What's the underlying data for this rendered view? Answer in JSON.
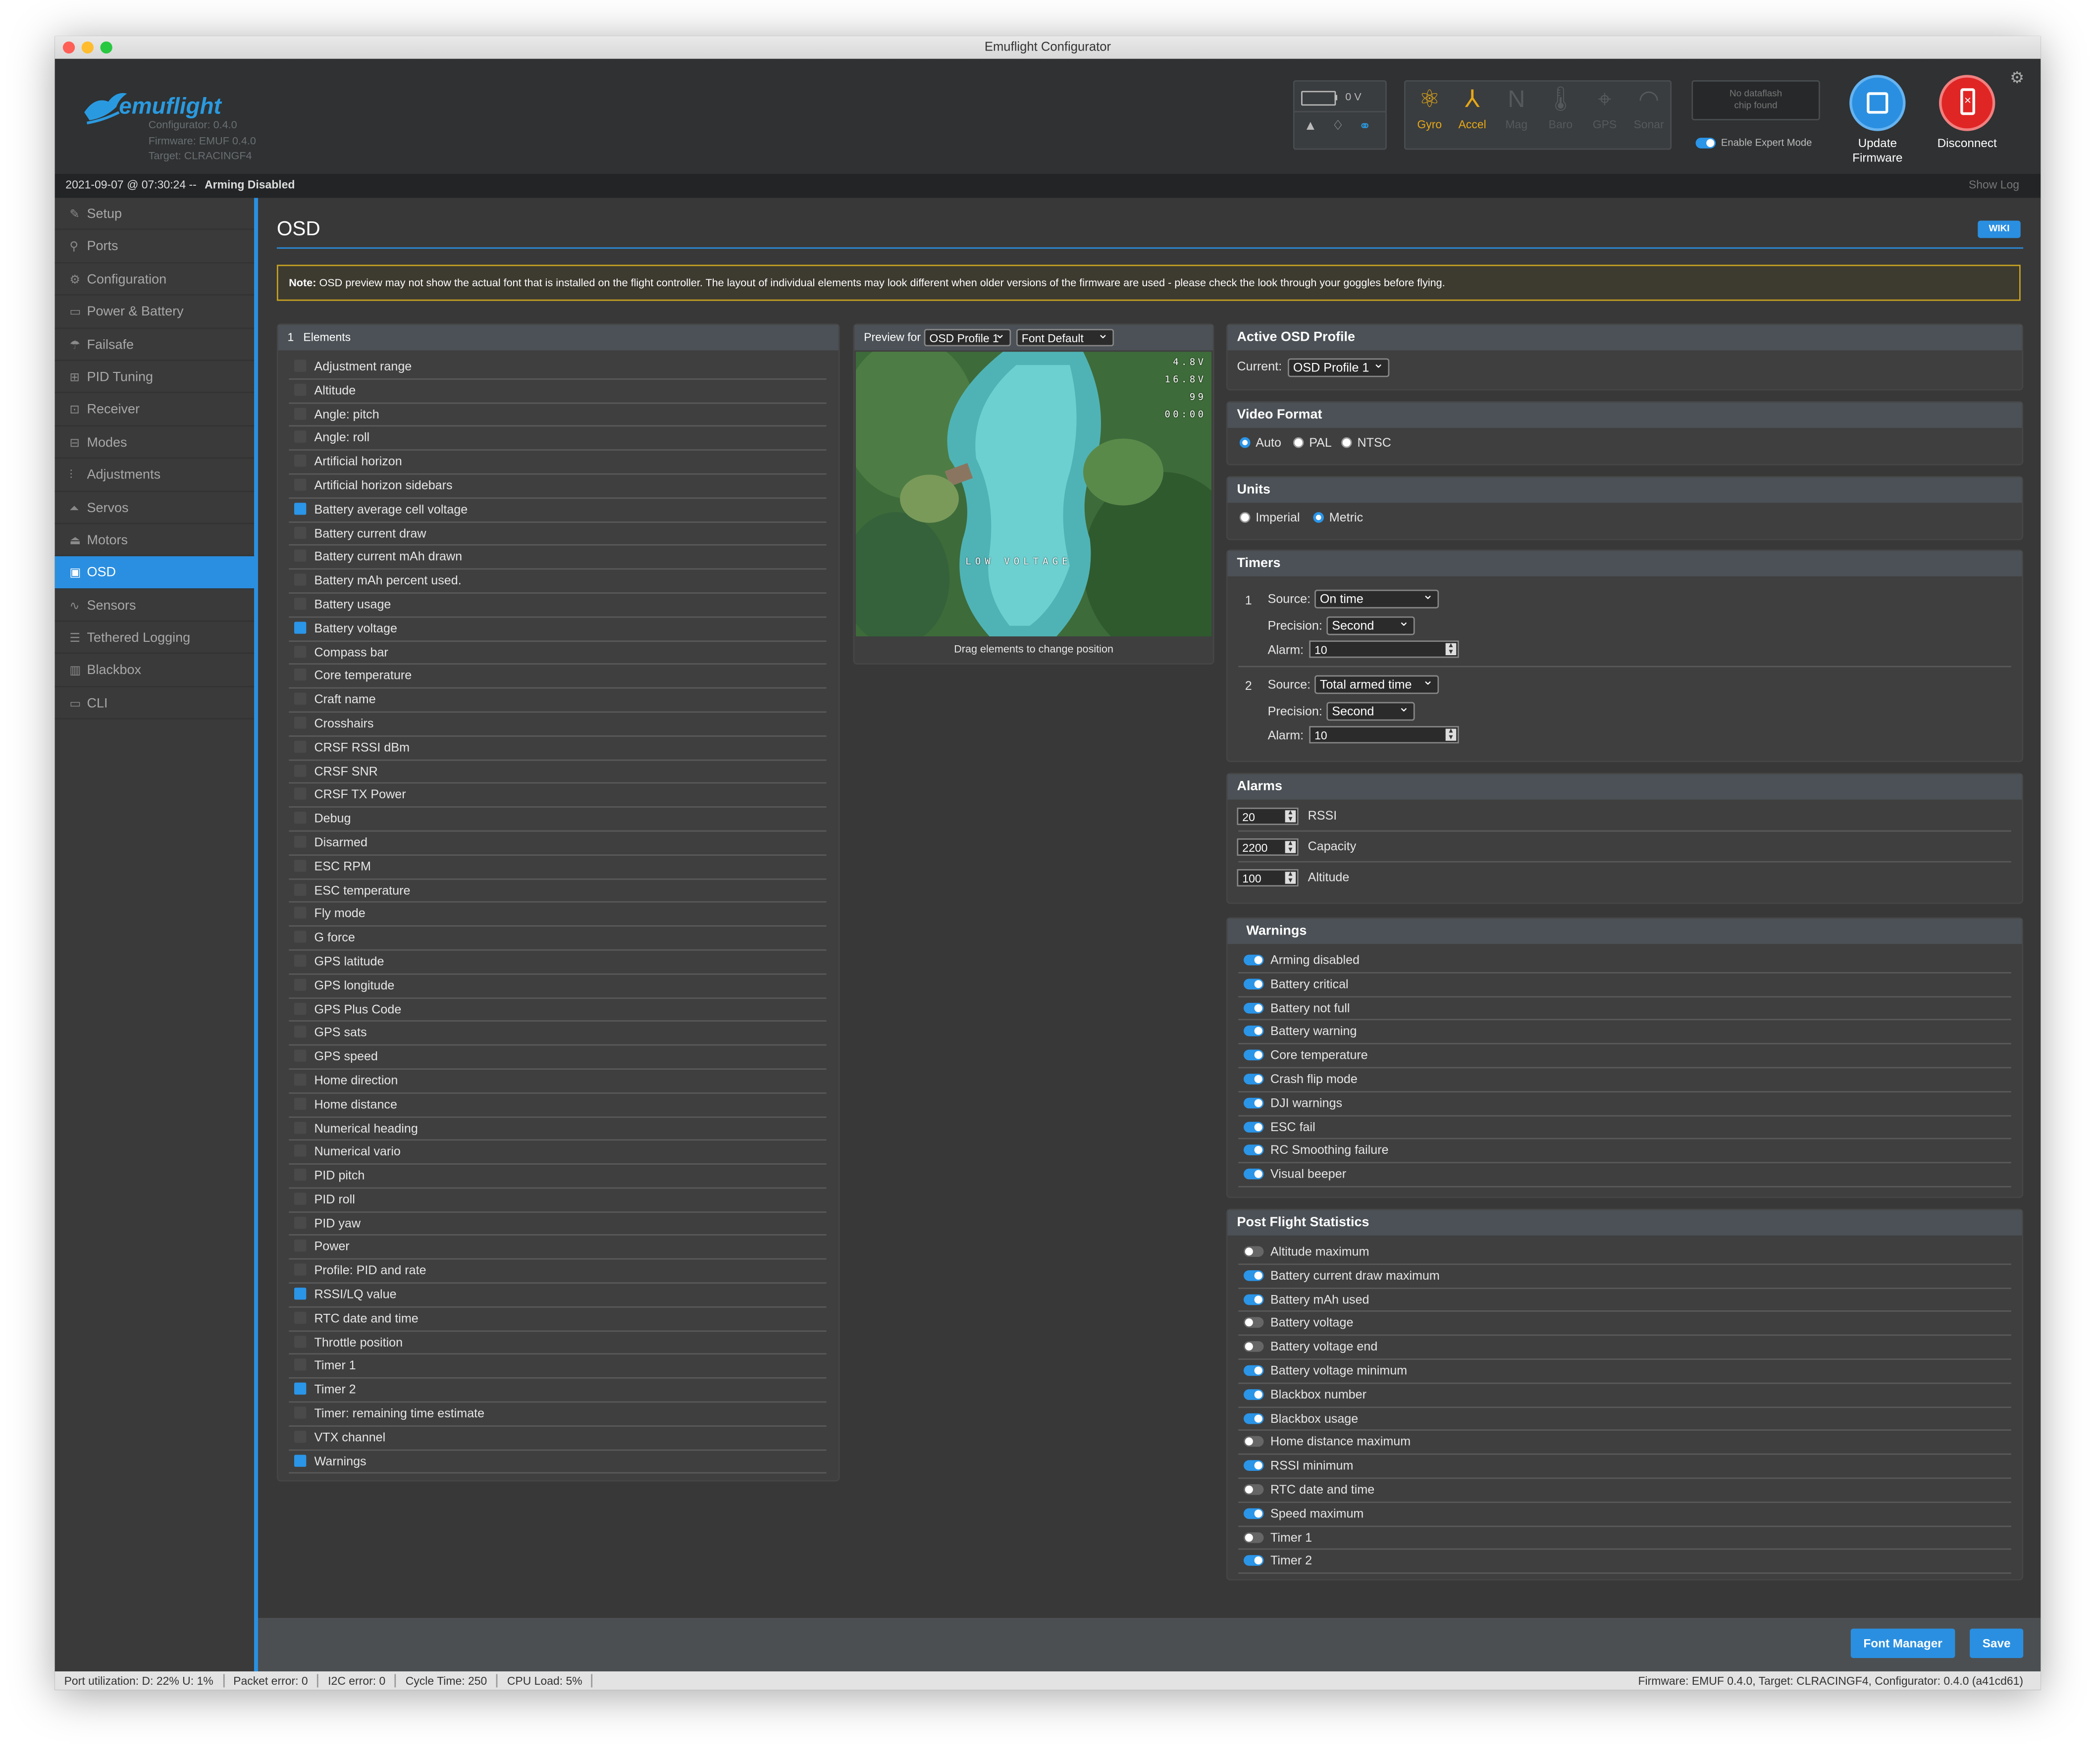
{
  "window": {
    "title": "Emuflight Configurator"
  },
  "colors": {
    "accent": "#2a8fe0",
    "disconnect": "#e02525",
    "note_border": "#c9a521"
  },
  "header": {
    "logo_text": "emuflight",
    "configurator_version": "Configurator: 0.4.0",
    "firmware_version": "Firmware: EMUF 0.4.0",
    "target": "Target: CLRACINGF4",
    "battery_voltage": "0 V",
    "sensors": [
      {
        "label": "Gyro",
        "icon": "gyro-icon",
        "active": true
      },
      {
        "label": "Accel",
        "icon": "accel-icon",
        "active": true
      },
      {
        "label": "Mag",
        "icon": "mag-icon",
        "active": false
      },
      {
        "label": "Baro",
        "icon": "baro-icon",
        "active": false
      },
      {
        "label": "GPS",
        "icon": "gps-icon",
        "active": false
      },
      {
        "label": "Sonar",
        "icon": "sonar-icon",
        "active": false
      }
    ],
    "dataflash_line1": "No dataflash",
    "dataflash_line2": "chip found",
    "expert_mode_label": "Enable Expert Mode",
    "update_firmware_line1": "Update",
    "update_firmware_line2": "Firmware",
    "disconnect_label": "Disconnect"
  },
  "status": {
    "datetime": "2021-09-07 @ 07:30:24 --",
    "arming": "Arming Disabled",
    "show_log": "Show Log"
  },
  "sidebar": {
    "items": [
      {
        "label": "Setup",
        "icon": "wrench-icon",
        "glyph": "✎"
      },
      {
        "label": "Ports",
        "icon": "plug-icon",
        "glyph": "⚲"
      },
      {
        "label": "Configuration",
        "icon": "gear-icon",
        "glyph": "⚙"
      },
      {
        "label": "Power & Battery",
        "icon": "battery-icon",
        "glyph": "▭"
      },
      {
        "label": "Failsafe",
        "icon": "parachute-icon",
        "glyph": "☂"
      },
      {
        "label": "PID Tuning",
        "icon": "pid-icon",
        "glyph": "⊞"
      },
      {
        "label": "Receiver",
        "icon": "receiver-icon",
        "glyph": "⊡"
      },
      {
        "label": "Modes",
        "icon": "modes-icon",
        "glyph": "⊟"
      },
      {
        "label": "Adjustments",
        "icon": "sliders-icon",
        "glyph": "⫶"
      },
      {
        "label": "Servos",
        "icon": "servo-icon",
        "glyph": "⏶"
      },
      {
        "label": "Motors",
        "icon": "motor-icon",
        "glyph": "⏏"
      },
      {
        "label": "OSD",
        "icon": "osd-icon",
        "glyph": "▣"
      },
      {
        "label": "Sensors",
        "icon": "sensors-icon",
        "glyph": "∿"
      },
      {
        "label": "Tethered Logging",
        "icon": "logging-icon",
        "glyph": "☰"
      },
      {
        "label": "Blackbox",
        "icon": "blackbox-icon",
        "glyph": "▥"
      },
      {
        "label": "CLI",
        "icon": "cli-icon",
        "glyph": "▭"
      }
    ],
    "active_index": 11
  },
  "page": {
    "title": "OSD",
    "wiki": "WIKI",
    "note_label": "Note:",
    "note_text": "OSD preview may not show the actual font that is installed on the flight controller. The layout of individual elements may look different when older versions of the firmware are used - please check the look through your goggles before flying."
  },
  "elements": {
    "index": "1",
    "title": "Elements",
    "items": [
      {
        "label": "Adjustment range",
        "checked": false
      },
      {
        "label": "Altitude",
        "checked": false
      },
      {
        "label": "Angle: pitch",
        "checked": false
      },
      {
        "label": "Angle: roll",
        "checked": false
      },
      {
        "label": "Artificial horizon",
        "checked": false
      },
      {
        "label": "Artificial horizon sidebars",
        "checked": false
      },
      {
        "label": "Battery average cell voltage",
        "checked": true
      },
      {
        "label": "Battery current draw",
        "checked": false
      },
      {
        "label": "Battery current mAh drawn",
        "checked": false
      },
      {
        "label": "Battery mAh percent used.",
        "checked": false
      },
      {
        "label": "Battery usage",
        "checked": false
      },
      {
        "label": "Battery voltage",
        "checked": true
      },
      {
        "label": "Compass bar",
        "checked": false
      },
      {
        "label": "Core temperature",
        "checked": false
      },
      {
        "label": "Craft name",
        "checked": false
      },
      {
        "label": "Crosshairs",
        "checked": false
      },
      {
        "label": "CRSF RSSI dBm",
        "checked": false
      },
      {
        "label": "CRSF SNR",
        "checked": false
      },
      {
        "label": "CRSF TX Power",
        "checked": false
      },
      {
        "label": "Debug",
        "checked": false
      },
      {
        "label": "Disarmed",
        "checked": false
      },
      {
        "label": "ESC RPM",
        "checked": false
      },
      {
        "label": "ESC temperature",
        "checked": false
      },
      {
        "label": "Fly mode",
        "checked": false
      },
      {
        "label": "G force",
        "checked": false
      },
      {
        "label": "GPS latitude",
        "checked": false
      },
      {
        "label": "GPS longitude",
        "checked": false
      },
      {
        "label": "GPS Plus Code",
        "checked": false
      },
      {
        "label": "GPS sats",
        "checked": false
      },
      {
        "label": "GPS speed",
        "checked": false
      },
      {
        "label": "Home direction",
        "checked": false
      },
      {
        "label": "Home distance",
        "checked": false
      },
      {
        "label": "Numerical heading",
        "checked": false
      },
      {
        "label": "Numerical vario",
        "checked": false
      },
      {
        "label": "PID pitch",
        "checked": false
      },
      {
        "label": "PID roll",
        "checked": false
      },
      {
        "label": "PID yaw",
        "checked": false
      },
      {
        "label": "Power",
        "checked": false
      },
      {
        "label": "Profile: PID and rate",
        "checked": false
      },
      {
        "label": "RSSI/LQ value",
        "checked": true
      },
      {
        "label": "RTC date and time",
        "checked": false
      },
      {
        "label": "Throttle position",
        "checked": false
      },
      {
        "label": "Timer 1",
        "checked": false
      },
      {
        "label": "Timer 2",
        "checked": true
      },
      {
        "label": "Timer: remaining time estimate",
        "checked": false
      },
      {
        "label": "VTX channel",
        "checked": false
      },
      {
        "label": "Warnings",
        "checked": true
      }
    ]
  },
  "preview": {
    "label": "Preview for",
    "profile": "OSD Profile 1",
    "font": "Font Default",
    "osd_warning": "LOW VOLTAGE",
    "osd_line1": "4.8V",
    "osd_line2": "16.8V",
    "osd_line3": "99",
    "osd_line4": "00:00",
    "caption": "Drag elements to change position"
  },
  "active_profile": {
    "title": "Active OSD Profile",
    "current_label": "Current:",
    "current_value": "OSD Profile 1"
  },
  "video_format": {
    "title": "Video Format",
    "options": [
      "Auto",
      "PAL",
      "NTSC"
    ],
    "selected": "Auto"
  },
  "units": {
    "title": "Units",
    "options": [
      "Imperial",
      "Metric"
    ],
    "selected": "Metric"
  },
  "timers": {
    "title": "Timers",
    "source_label": "Source:",
    "precision_label": "Precision:",
    "alarm_label": "Alarm:",
    "items": [
      {
        "index": "1",
        "source": "On time",
        "precision": "Second",
        "alarm": "10"
      },
      {
        "index": "2",
        "source": "Total armed time",
        "precision": "Second",
        "alarm": "10"
      }
    ]
  },
  "alarms": {
    "title": "Alarms",
    "items": [
      {
        "value": "20",
        "label": "RSSI"
      },
      {
        "value": "2200",
        "label": "Capacity"
      },
      {
        "value": "100",
        "label": "Altitude"
      }
    ]
  },
  "warnings": {
    "title": "Warnings",
    "items": [
      {
        "label": "Arming disabled",
        "on": true
      },
      {
        "label": "Battery critical",
        "on": true
      },
      {
        "label": "Battery not full",
        "on": true
      },
      {
        "label": "Battery warning",
        "on": true
      },
      {
        "label": "Core temperature",
        "on": true
      },
      {
        "label": "Crash flip mode",
        "on": true
      },
      {
        "label": "DJI warnings",
        "on": true
      },
      {
        "label": "ESC fail",
        "on": true
      },
      {
        "label": "RC Smoothing failure",
        "on": true
      },
      {
        "label": "Visual beeper",
        "on": true
      }
    ]
  },
  "post_flight": {
    "title": "Post Flight Statistics",
    "items": [
      {
        "label": "Altitude maximum",
        "on": false
      },
      {
        "label": "Battery current draw maximum",
        "on": true
      },
      {
        "label": "Battery mAh used",
        "on": true
      },
      {
        "label": "Battery voltage",
        "on": false
      },
      {
        "label": "Battery voltage end",
        "on": false
      },
      {
        "label": "Battery voltage minimum",
        "on": true
      },
      {
        "label": "Blackbox number",
        "on": true
      },
      {
        "label": "Blackbox usage",
        "on": true
      },
      {
        "label": "Home distance maximum",
        "on": false
      },
      {
        "label": "RSSI minimum",
        "on": true
      },
      {
        "label": "RTC date and time",
        "on": false
      },
      {
        "label": "Speed maximum",
        "on": true
      },
      {
        "label": "Timer 1",
        "on": false
      },
      {
        "label": "Timer 2",
        "on": true
      }
    ]
  },
  "footer": {
    "font_manager": "Font Manager",
    "save": "Save"
  },
  "bottom": {
    "port_util": "Port utilization: D: 22% U: 1%",
    "packet_error": "Packet error: 0",
    "i2c_error": "I2C error: 0",
    "cycle_time": "Cycle Time: 250",
    "cpu_load": "CPU Load: 5%",
    "firmware_info": "Firmware: EMUF 0.4.0, Target: CLRACINGF4, Configurator: 0.4.0 (a41cd61)"
  }
}
